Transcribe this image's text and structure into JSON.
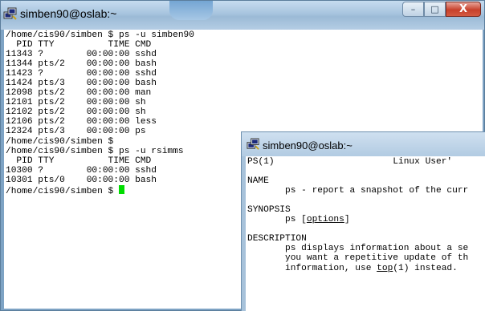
{
  "window1": {
    "title": "simben90@oslab:~",
    "icon": "putty-terminal-icon",
    "controls": {
      "minimize": "–",
      "maximize": "□",
      "close": "X"
    }
  },
  "terminal1": {
    "lines": [
      "/home/cis90/simben $ ps -u simben90",
      "  PID TTY          TIME CMD",
      "11343 ?        00:00:00 sshd",
      "11344 pts/2    00:00:00 bash",
      "11423 ?        00:00:00 sshd",
      "11424 pts/3    00:00:00 bash",
      "12098 pts/2    00:00:00 man",
      "12101 pts/2    00:00:00 sh",
      "12102 pts/2    00:00:00 sh",
      "12106 pts/2    00:00:00 less",
      "12324 pts/3    00:00:00 ps",
      "/home/cis90/simben $",
      "/home/cis90/simben $ ps -u rsimms",
      "  PID TTY          TIME CMD",
      "10300 ?        00:00:00 sshd",
      "10301 pts/0    00:00:00 bash"
    ],
    "prompt": "/home/cis90/simben $ "
  },
  "window2": {
    "title": "simben90@oslab:~",
    "icon": "putty-terminal-icon"
  },
  "terminal2": {
    "header_left": "PS(1)",
    "header_right": "Linux User'",
    "name_heading": "NAME",
    "name_text": "       ps - report a snapshot of the curr",
    "synopsis_heading": "SYNOPSIS",
    "synopsis_prefix": "       ps [",
    "synopsis_link": "options",
    "synopsis_suffix": "]",
    "description_heading": "DESCRIPTION",
    "desc_line1": "       ps displays information about a se",
    "desc_line2": "       you want a repetitive update of th",
    "desc_line3_prefix": "       information, use ",
    "desc_line3_link": "top",
    "desc_line3_suffix": "(1) instead."
  },
  "colors": {
    "cursor": "#00dd00",
    "titlebar": "#a7c4de",
    "close_button": "#c7402b"
  }
}
